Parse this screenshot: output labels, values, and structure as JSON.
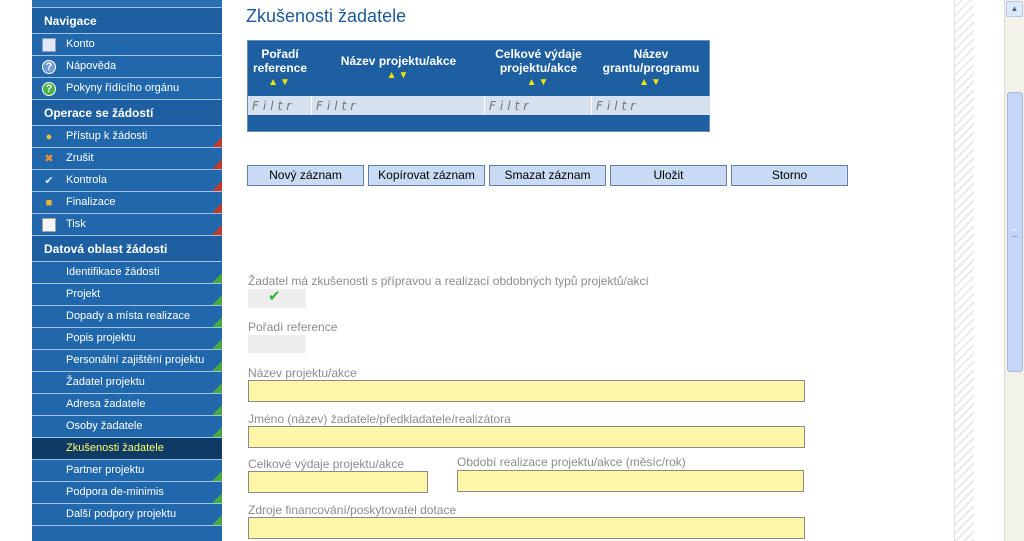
{
  "sidebar": {
    "sections": [
      {
        "title": "Navigace",
        "items": [
          {
            "label": "Konto",
            "icon": "konto-icon",
            "active": false
          },
          {
            "label": "Nápověda",
            "icon": "help-icon",
            "active": false
          },
          {
            "label": "Pokyny řídícího orgánu",
            "icon": "pokyny-icon",
            "active": false
          }
        ]
      },
      {
        "title": "Operace se žádostí",
        "items": [
          {
            "label": "Přístup k žádosti",
            "icon": "users-icon",
            "active": false
          },
          {
            "label": "Zrušit",
            "icon": "cancel-icon",
            "active": false
          },
          {
            "label": "Kontrola",
            "icon": "checkmark-icon",
            "active": false
          },
          {
            "label": "Finalizace",
            "icon": "lock-icon",
            "active": false
          },
          {
            "label": "Tisk",
            "icon": "document-icon",
            "active": false
          }
        ]
      },
      {
        "title": "Datová oblast žádosti",
        "items": [
          {
            "label": "Identifikace žádosti",
            "active": false
          },
          {
            "label": "Projekt",
            "active": false
          },
          {
            "label": "Dopady a místa realizace",
            "active": false
          },
          {
            "label": "Popis projektu",
            "active": false
          },
          {
            "label": "Personální zajištění projektu",
            "active": false
          },
          {
            "label": "Žadatel projektu",
            "active": false
          },
          {
            "label": "Adresa žadatele",
            "active": false
          },
          {
            "label": "Osoby žadatele",
            "active": false
          },
          {
            "label": "Zkušenosti žadatele",
            "active": true
          },
          {
            "label": "Partner projektu",
            "active": false
          },
          {
            "label": "Podpora de-minimis",
            "active": false
          },
          {
            "label": "Další podpory projektu",
            "active": false
          }
        ]
      }
    ]
  },
  "page": {
    "title": "Zkušenosti žadatele"
  },
  "grid": {
    "columns": [
      {
        "line1": "Pořadí",
        "line2": "reference",
        "sort": "▲▼"
      },
      {
        "line1": "Název projektu/akce",
        "line2": "",
        "sort": "▲▼"
      },
      {
        "line1": "Celkové výdaje",
        "line2": "projektu/akce",
        "sort": "▲▼"
      },
      {
        "line1": "Název",
        "line2": "grantu/programu",
        "sort": "▲▼"
      }
    ],
    "filter_placeholder": "Filtr"
  },
  "toolbar": {
    "new": "Nový záznam",
    "copy": "Kopírovat záznam",
    "delete": "Smazat záznam",
    "save": "Uložit",
    "cancel": "Storno"
  },
  "form": {
    "experience_label": "Žadatel má zkušenosti s přípravou a realizací obdobných typů projektů/akcí",
    "experience_checked": true,
    "order_label": "Pořadí reference",
    "order_value": "",
    "project_name_label": "Název projektu/akce",
    "project_name_value": "",
    "applicant_name_label": "Jméno (název) žadatele/předkladatele/realizátora",
    "applicant_name_value": "",
    "total_cost_label": "Celkové výdaje projektu/akce",
    "total_cost_value": "",
    "period_label": "Období realizace projektu/akce (měsíc/rok)",
    "period_value": "",
    "sources_label": "Zdroje financování/poskytovatel dotace",
    "sources_value": ""
  },
  "colors": {
    "sidebar_bg": "#1d5fa1",
    "active_item_bg": "#0e3a66",
    "active_item_text": "#ffff66",
    "required_field_bg": "#fff6a8",
    "button_bg": "#c8daf4"
  }
}
